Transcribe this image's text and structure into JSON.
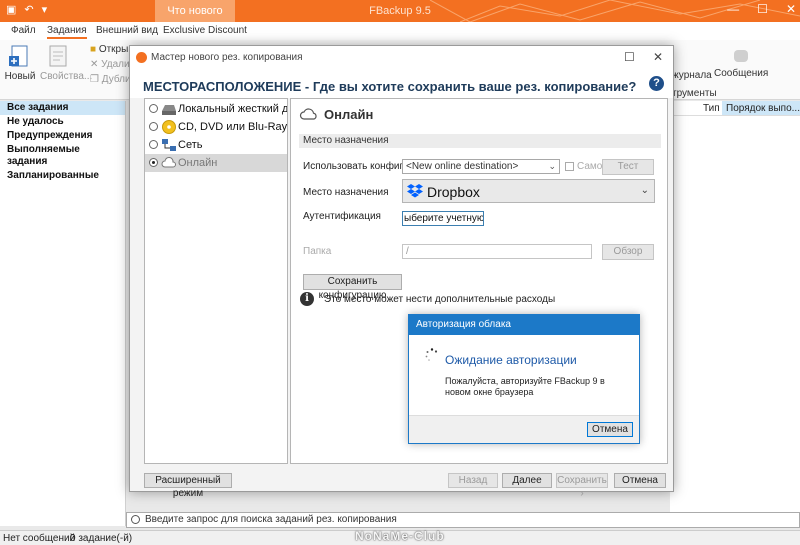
{
  "app": {
    "title": "FBackup 9.5",
    "context_tab": "Что нового",
    "window_controls": {
      "minimize": "—",
      "maximize": "☐",
      "close": "✕"
    }
  },
  "ribbon": {
    "tabs": [
      {
        "label": "Файл",
        "active": false
      },
      {
        "label": "Задания",
        "active": true
      },
      {
        "label": "Внешний вид",
        "active": false
      },
      {
        "label": "Exclusive Discount",
        "active": false
      }
    ],
    "new_label": "Новый",
    "properties_label": "Свойства...",
    "open_label": "Откры",
    "delete_label": "Удалит",
    "duplicate_label": "Дубли",
    "journal_label": "журнала",
    "messages_label": "Сообщения",
    "group_tools": "трументы"
  },
  "left_nav": {
    "items": [
      {
        "label": "Все задания",
        "selected": true
      },
      {
        "label": "Не удалось",
        "selected": false
      },
      {
        "label": "Предупреждения",
        "selected": false
      },
      {
        "label": "Выполняемые задания",
        "selected": false
      },
      {
        "label": "Запланированные",
        "selected": false
      }
    ]
  },
  "columns": {
    "type": "Тип",
    "order": "Порядок выпо..."
  },
  "search": {
    "placeholder": "Введите запрос для поиска заданий рез. копирования"
  },
  "statusbar": {
    "messages": "Нет сообщений",
    "jobs": "0 задание(-й)"
  },
  "watermark": "NoNaMe-Club",
  "wizard": {
    "title": "Мастер нового рез. копирования",
    "heading": "МЕСТОРАСПОЛОЖЕНИЕ - Где вы хотите сохранить ваше рез. копирование?",
    "help": "?",
    "destinations": [
      {
        "label": "Локальный жесткий дис",
        "icon": "hard-drive-icon",
        "selected": false
      },
      {
        "label": "CD, DVD или Blu-Ray",
        "icon": "disc-icon",
        "selected": false
      },
      {
        "label": "Сеть",
        "icon": "network-icon",
        "selected": false
      },
      {
        "label": "Онлайн",
        "icon": "cloud-icon",
        "selected": true
      }
    ],
    "panel": {
      "title": "Онлайн",
      "section": "Место назначения",
      "use_config_label": "Использовать конфигурации",
      "use_config_value": "<New online destination>",
      "same_label": "Само",
      "test_button": "Тест",
      "dest_label": "Место назначения",
      "dest_value": "Dropbox",
      "auth_label": "Аутентификация",
      "auth_button": "ыберите учетную запи",
      "folder_label": "Папка",
      "folder_value": "/",
      "browse_button": "Обзор",
      "save_config_button": "Сохранить конфигурацию",
      "info_text": "Это место может нести дополнительные расходы"
    },
    "footer": {
      "advanced": "Расширенный режим",
      "back": "Назад",
      "next": "Далее",
      "save": "Сохранить",
      "cancel": "Отмена"
    }
  },
  "auth_dialog": {
    "title": "Авторизация облака",
    "waiting": "Ожидание авторизации",
    "message": "Пожалуйста, авторизуйте FBackup 9 в новом окне браузера",
    "cancel": "Отмена"
  },
  "colors": {
    "accent": "#f37021",
    "dialog_blue": "#1c79c8",
    "heading": "#1e3b5a",
    "dropbox": "#0061ff"
  }
}
